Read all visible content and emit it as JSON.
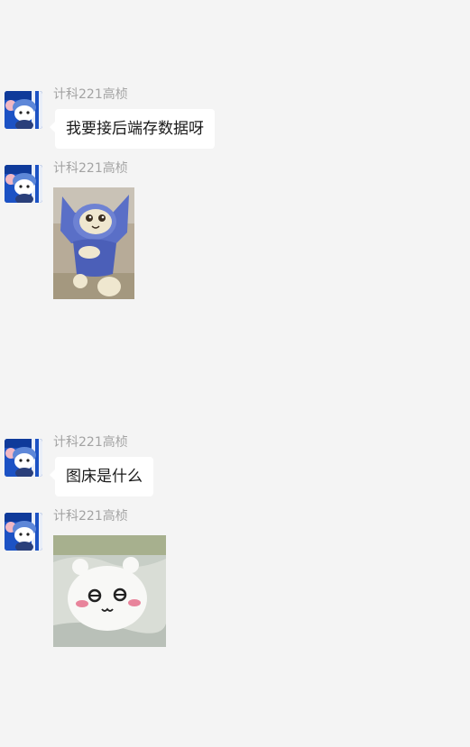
{
  "colors": {
    "background": "#f4f4f4",
    "bubble": "#ffffff",
    "sender_name": "#a3a3a3",
    "text": "#1a1a1a"
  },
  "messages": [
    {
      "sender": "计科221高桢",
      "type": "text",
      "text": "我要接后端存数据呀",
      "avatar_icon": "cartoon-mouse-avatar"
    },
    {
      "sender": "计科221高桢",
      "type": "sticker",
      "sticker_icon": "blue-hooded-cat-sticker",
      "avatar_icon": "cartoon-mouse-avatar"
    },
    {
      "sender": "计科221高桢",
      "type": "text",
      "text": "图床是什么",
      "avatar_icon": "cartoon-mouse-avatar"
    },
    {
      "sender": "计科221高桢",
      "type": "sticker",
      "sticker_icon": "white-blob-creature-sticker",
      "avatar_icon": "cartoon-mouse-avatar"
    }
  ]
}
